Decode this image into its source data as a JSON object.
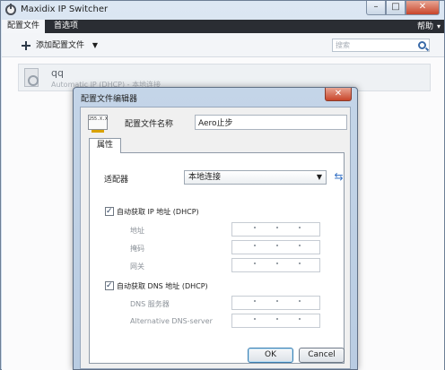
{
  "window": {
    "title": "Maxidix IP Switcher",
    "caption": {
      "minimize": "–",
      "maximize": "□",
      "close": "✕"
    }
  },
  "menu": {
    "items": [
      "配置文件",
      "首选项"
    ],
    "help": "帮助"
  },
  "toolbar": {
    "add_label": "添加配置文件",
    "search_placeholder": "搜索"
  },
  "profile": {
    "name": "qq",
    "meta": "Automatic IP (DHCP)  -  本地连接"
  },
  "dialog": {
    "title": "配置文件编辑器",
    "close": "✕",
    "name_icon_text": "255.X.X",
    "name_label": "配置文件名称",
    "name_value": "Aero止步",
    "tab": "属性",
    "adapter_label": "适配器",
    "adapter_value": "本地连接",
    "dhcp_ip": {
      "label": "自动获取 IP 地址 (DHCP)",
      "checked": true
    },
    "ip_fields": [
      "地址",
      "掩码",
      "网关"
    ],
    "dhcp_dns": {
      "label": "自动获取 DNS 地址 (DHCP)",
      "checked": true
    },
    "dns_fields": [
      "DNS 服务器",
      "Alternative DNS-server"
    ],
    "ok": "OK",
    "cancel": "Cancel"
  },
  "colors": {
    "menubar": "#2a2d33",
    "accent": "#3874c6",
    "close_button": "#c8452a"
  }
}
